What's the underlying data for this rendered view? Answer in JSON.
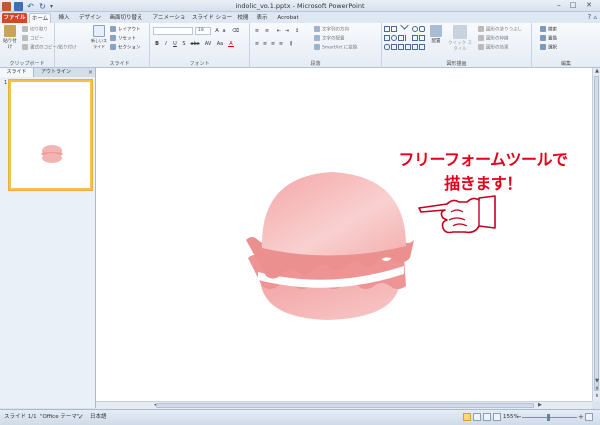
{
  "window": {
    "title": "indolic_vo.1.pptx - Microsoft PowerPoint",
    "controls": [
      "–",
      "□",
      "✕"
    ]
  },
  "tabs": [
    {
      "label": "ファイル"
    },
    {
      "label": "ホーム"
    },
    {
      "label": "挿入"
    },
    {
      "label": "デザイン"
    },
    {
      "label": "画面切り替え"
    },
    {
      "label": "アニメーション"
    },
    {
      "label": "スライド ショー"
    },
    {
      "label": "校閲"
    },
    {
      "label": "表示"
    },
    {
      "label": "Acrobat"
    }
  ],
  "ribbon": {
    "clipboard": {
      "paste": "貼り付け",
      "cut": "切り取り",
      "copy": "コピー",
      "format_painter": "書式のコピー/貼り付け",
      "label": "クリップボード"
    },
    "slides": {
      "new_slide": "新しいスライド",
      "layout": "レイアウト",
      "reset": "リセット",
      "section": "セクション",
      "label": "スライド"
    },
    "font": {
      "size": "18",
      "label": "フォント",
      "buttons": [
        "B",
        "I",
        "U",
        "S",
        "abc",
        "AV",
        "Aa",
        "A"
      ]
    },
    "paragraph": {
      "text_direction": "文字列の方向",
      "align_text": "文字の配置",
      "smartart": "SmartArt に変換",
      "label": "段落"
    },
    "drawing": {
      "arrange": "配置",
      "quick_styles": "クイック スタイル",
      "shape_fill": "図形の塗りつぶし",
      "shape_outline": "図形の枠線",
      "shape_effects": "図形の効果",
      "label": "図形描画"
    },
    "editing": {
      "find": "検索",
      "replace": "置換",
      "select": "選択",
      "label": "編集"
    }
  },
  "left_panel": {
    "tab_slides": "スライド",
    "tab_outline": "アウトライン",
    "close": "×",
    "slide_number": "1"
  },
  "slide": {
    "text_line1": "フリーフォームツールで",
    "text_line2": "描きます！"
  },
  "status": {
    "slide_info": "スライド 1/1",
    "theme": "\"Office テーマ\"",
    "language": "日本語",
    "zoom": "155%",
    "zoom_minus": "−",
    "zoom_plus": "+"
  },
  "colors": {
    "accent_file_tab": "#d24726",
    "slide_text": "#e2001a",
    "macaron_pink": "#f2a0a0",
    "macaron_fill_light": "#f9d6d6",
    "thumb_border": "#f2c14e"
  }
}
